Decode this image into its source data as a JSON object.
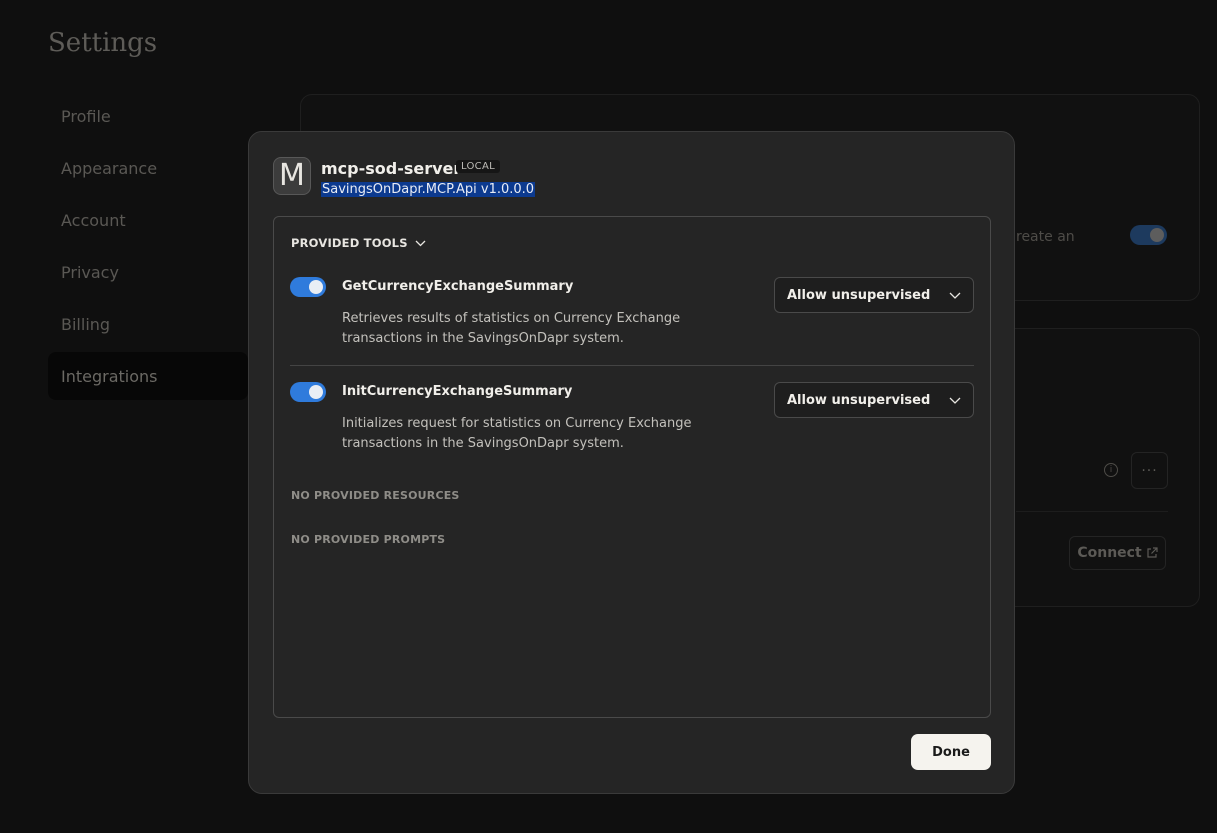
{
  "settings": {
    "title": "Settings",
    "nav": [
      {
        "label": "Profile"
      },
      {
        "label": "Appearance"
      },
      {
        "label": "Account"
      },
      {
        "label": "Privacy"
      },
      {
        "label": "Billing"
      },
      {
        "label": "Integrations",
        "active": true
      }
    ],
    "background": {
      "fragment_text": "reate an",
      "more_label": "···",
      "connect_label": "Connect",
      "info_glyph": "i"
    }
  },
  "modal": {
    "server_avatar_letter": "M",
    "server_name": "mcp-sod-server",
    "badge": "LOCAL",
    "version": "SavingsOnDapr.MCP.Api v1.0.0.0",
    "tools_header": "PROVIDED TOOLS",
    "tools": [
      {
        "name": "GetCurrencyExchangeSummary",
        "description": "Retrieves results of statistics on Currency Exchange transactions in the SavingsOnDapr system.",
        "enabled": true,
        "permission": "Allow unsupervised"
      },
      {
        "name": "InitCurrencyExchangeSummary",
        "description": "Initializes request for statistics on Currency Exchange transactions in the SavingsOnDapr system.",
        "enabled": true,
        "permission": "Allow unsupervised"
      }
    ],
    "resources_label": "NO PROVIDED RESOURCES",
    "prompts_label": "NO PROVIDED PROMPTS",
    "done_label": "Done"
  },
  "colors": {
    "accent": "#2f7bdc",
    "selection": "#0c3a8f",
    "modal_bg": "#252525"
  }
}
